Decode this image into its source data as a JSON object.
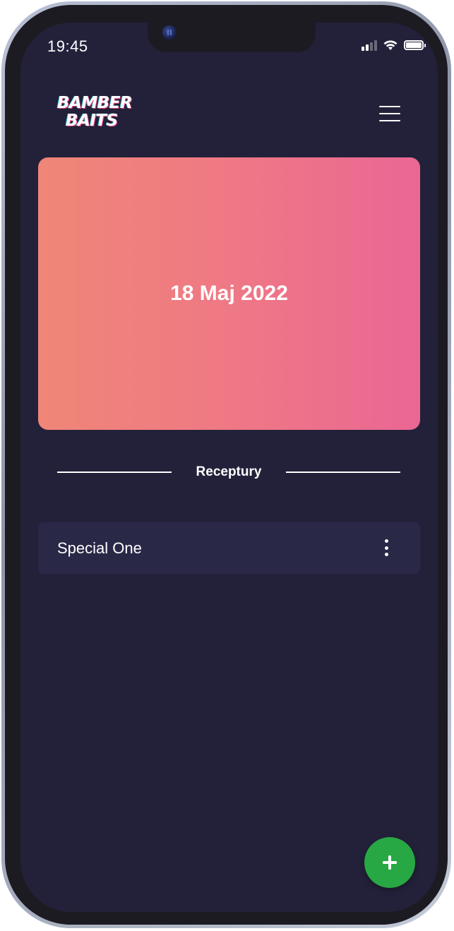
{
  "status_bar": {
    "time": "19:45",
    "icons": [
      "signal-icon",
      "wifi-icon",
      "battery-icon"
    ]
  },
  "header": {
    "logo_line1": "BAMBER",
    "logo_line2": "BAITS",
    "menu_icon": "hamburger-menu-icon"
  },
  "date_card": {
    "date": "18 Maj 2022",
    "gradient_start": "#ef8677",
    "gradient_end": "#ea6794"
  },
  "section": {
    "title": "Receptury"
  },
  "recipes": [
    {
      "name": "Special One",
      "menu_icon": "more-vertical-icon"
    }
  ],
  "fab": {
    "icon": "plus-icon",
    "color": "#27a844"
  },
  "colors": {
    "background": "#23213a",
    "list_item": "#2a2847",
    "accent": "#27a844"
  }
}
